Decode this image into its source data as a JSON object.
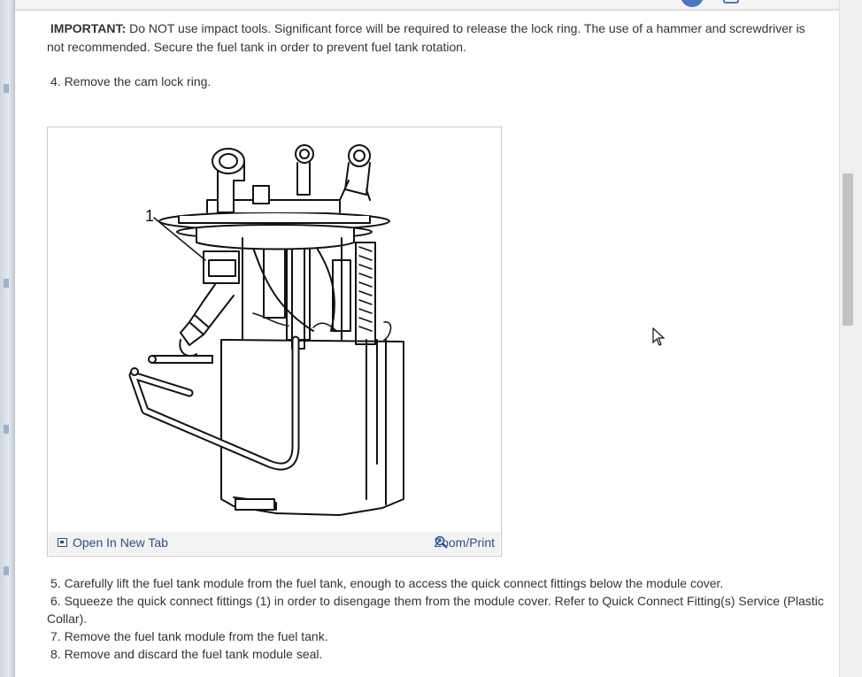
{
  "content": {
    "important_label": "IMPORTANT:",
    "important_text": " Do NOT use impact tools. Significant force will be required to release the lock ring. The use of a hammer and screwdriver is not recommended. Secure the fuel tank in order to prevent fuel tank rotation.",
    "step_4": "4. Remove the cam lock ring."
  },
  "figure": {
    "callout": "1",
    "open_new_tab": "Open In New Tab",
    "zoom_print": "Zoom/Print",
    "open_icon": "open-in-new-tab-icon",
    "zoom_icon": "magnifier-zoom-icon"
  },
  "steps": [
    "5. Carefully lift the fuel tank module from the fuel tank, enough to access the quick connect fittings below the module cover.",
    "6. Squeeze the quick connect fittings (1) in order to disengage them from the module cover. Refer to Quick Connect Fitting(s) Service (Plastic Collar).",
    "7. Remove the fuel tank module from the fuel tank.",
    "8. Remove and discard the fuel tank module seal."
  ],
  "colors": {
    "link": "#2a4f86",
    "accent": "#4a78b8",
    "figure_bar": "#f2f2f2"
  }
}
